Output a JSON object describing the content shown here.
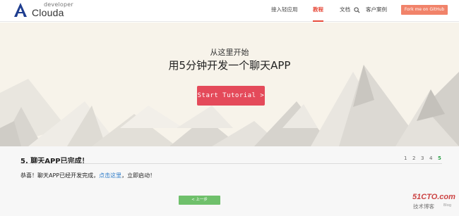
{
  "header": {
    "logo_sub": "developer",
    "logo_name": "Clouda",
    "nav": [
      {
        "label": "接入轻应用"
      },
      {
        "label": "教程"
      },
      {
        "label": "文档"
      },
      {
        "label": "客户案例"
      }
    ],
    "active_nav": "教程",
    "github_label": "Fork me on GitHub"
  },
  "hero": {
    "subtitle": "从这里开始",
    "title": "用5分钟开发一个聊天APP",
    "cta_label": "Start Tutorial >"
  },
  "content": {
    "step_title": "5. 聊天APP已完成！",
    "pages": [
      "1",
      "2",
      "3",
      "4",
      "5"
    ],
    "current_page": "5",
    "message_prefix": "恭喜！聊天APP已经开发完成，",
    "message_link": "点击这里",
    "message_suffix": "，立即启动！",
    "prev_label": "< 上一步"
  },
  "watermark": {
    "main": "51CTO.com",
    "sub": "技术博客",
    "blog": "Blog"
  },
  "colors": {
    "accent_red": "#e74c3c",
    "cta": "#e44a5a",
    "github": "#f1836a",
    "link": "#2c7bc8",
    "current_page": "#2fa24a",
    "prev_button": "#6fc06b"
  },
  "icons": {
    "logo": "clouda-a-logo-icon",
    "search": "search-icon"
  }
}
